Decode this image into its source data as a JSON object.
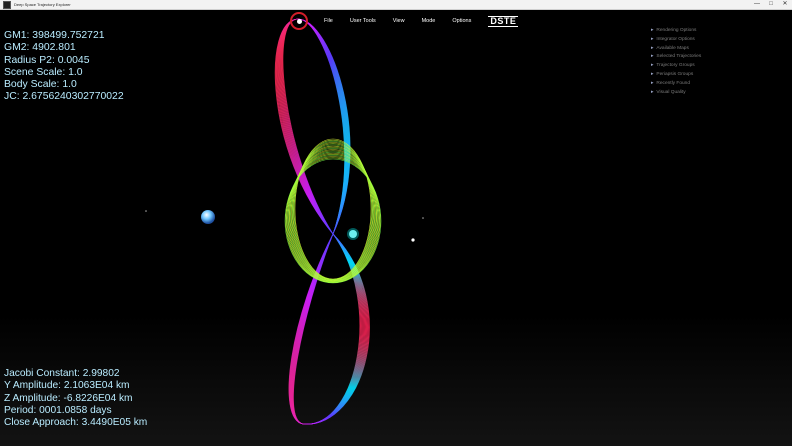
{
  "window": {
    "title": "Deep Space Trajectory Explorer",
    "minimize": "—",
    "maximize": "□",
    "close": "✕"
  },
  "menu": {
    "logo_icon": "orbit-logo-icon",
    "items": [
      "File",
      "User Tools",
      "View",
      "Mode",
      "Options"
    ],
    "brand": "DSTE"
  },
  "params": {
    "gm1": "GM1: 398499.752721",
    "gm2": "GM2: 4902.801",
    "radius_p2": "Radius P2: 0.0045",
    "scene_scale": "Scene Scale: 1.0",
    "body_scale": "Body Scale: 1.0",
    "jc": "JC: 2.6756240302770022"
  },
  "orbit_info": {
    "jacobi": "Jacobi Constant: 2.99802",
    "y_amp": "Y Amplitude: 2.1063E04 km",
    "z_amp": "Z Amplitude: -6.8226E04 km",
    "period": "Period: 0001.0858 days",
    "close_approach": "Close Approach: 3.4490E05 km"
  },
  "options_panel": {
    "items": [
      "Rendering Options",
      "Integrator Options",
      "Available Maps",
      "Selected Trajectories",
      "Trajectory Groups",
      "Periapsis Groups",
      "Recently Found",
      "Visual Quality"
    ]
  },
  "colors": {
    "accent": "#d21e2a",
    "text": "#b9ecff"
  }
}
